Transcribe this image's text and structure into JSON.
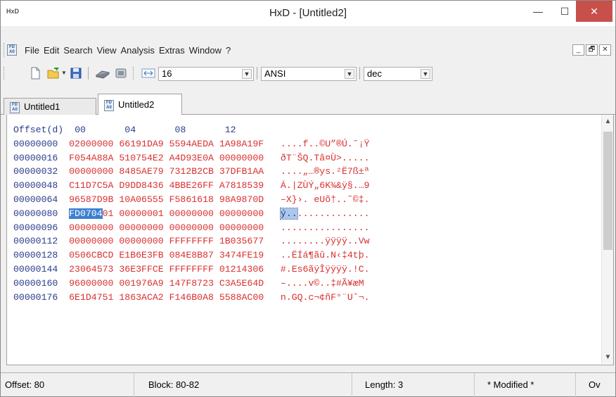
{
  "window": {
    "title": "HxD - [Untitled2]",
    "app_icon_text": "HxD",
    "minimize": "—",
    "maximize": "☐",
    "close": "✕"
  },
  "menu": {
    "items": [
      "File",
      "Edit",
      "Search",
      "View",
      "Analysis",
      "Extras",
      "Window",
      "?"
    ],
    "mdi_buttons": [
      "_",
      "🗗",
      "✕"
    ]
  },
  "toolbar": {
    "bytes_per_row": "16",
    "charset": "ANSI",
    "offset_base": "dec",
    "tools": [
      "new-file-icon",
      "open-folder-icon",
      "save-icon",
      "disk-icon",
      "ram-icon",
      "arrows-icon"
    ]
  },
  "tabs": [
    {
      "label": "Untitled1",
      "active": false
    },
    {
      "label": "Untitled2",
      "active": true
    }
  ],
  "hex_view": {
    "header": {
      "offset": "Offset(d)",
      "cols": [
        "00",
        "04",
        "08",
        "12"
      ]
    },
    "rows": [
      {
        "offset": "00000000",
        "groups": [
          "02000000",
          "66191DA9",
          "5594AEDA",
          "1A98A19F"
        ],
        "ascii": "....f..©U”®Ú.˜¡Ÿ"
      },
      {
        "offset": "00000016",
        "groups": [
          "F054A88A",
          "510754E2",
          "A4D93E0A",
          "00000000"
        ],
        "ascii": "ðT¨ŠQ.Tâ¤Ù>....."
      },
      {
        "offset": "00000032",
        "groups": [
          "00000000",
          "8485AE79",
          "7312B2CB",
          "37DFB1AA"
        ],
        "ascii": "....„…®ys.²Ë7ß±ª"
      },
      {
        "offset": "00000048",
        "groups": [
          "C11D7C5A",
          "D9DD8436",
          "4BBE26FF",
          "A7818539"
        ],
        "ascii": "Á.|ZÙÝ„6K¾&ÿ§.…9"
      },
      {
        "offset": "00000064",
        "groups": [
          "96587D9B",
          "10A06555",
          "F5861618",
          "98A9870D"
        ],
        "ascii": "–X}›. eUõ†..˜©‡."
      },
      {
        "offset": "00000080",
        "groups": [
          "FD070401",
          "00000001",
          "00000000",
          "00000000"
        ],
        "ascii": "ý..............."
      },
      {
        "offset": "00000096",
        "groups": [
          "00000000",
          "00000000",
          "00000000",
          "00000000"
        ],
        "ascii": "................"
      },
      {
        "offset": "00000112",
        "groups": [
          "00000000",
          "00000000",
          "FFFFFFFF",
          "1B035677"
        ],
        "ascii": "........ÿÿÿÿ..Vw"
      },
      {
        "offset": "00000128",
        "groups": [
          "0506CBCD",
          "E1B6E3FB",
          "084E8B87",
          "3474FE19"
        ],
        "ascii": "..ËÍá¶ãû.N‹‡4tþ."
      },
      {
        "offset": "00000144",
        "groups": [
          "23064573",
          "36E3FFCE",
          "FFFFFFFF",
          "01214306"
        ],
        "ascii": "#.Es6ãÿÎÿÿÿÿ.!C."
      },
      {
        "offset": "00000160",
        "groups": [
          "96000000",
          "001976A9",
          "147F8723",
          "C3A5E64D"
        ],
        "ascii": "–....v©..‡#Ã¥æM"
      },
      {
        "offset": "00000176",
        "groups": [
          "6E1D4751",
          "1863ACA2",
          "F146B0A8",
          "5588AC00"
        ],
        "ascii": "n.GQ.c¬¢ñF°¨Uˆ¬."
      }
    ],
    "selected_row_index": 5,
    "selected_hex_chars": 6,
    "selected_ascii_chars": 3
  },
  "status": {
    "offset": "Offset: 80",
    "block": "Block: 80-82",
    "length": "Length: 3",
    "modified": "* Modified *",
    "mode": "Ov"
  },
  "colors": {
    "offset_text": "#2a3d8c",
    "data_text": "#d93030",
    "selection": "#3c7fd2",
    "close_button": "#c7504a"
  }
}
